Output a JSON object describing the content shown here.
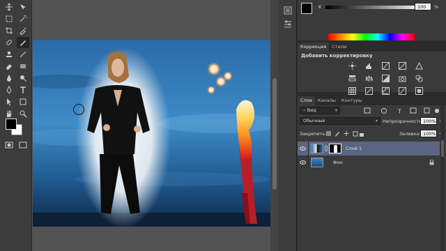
{
  "colors": {
    "sky_dark": "#1b3f63",
    "sky_light": "#3e86c2",
    "glow": "#e8eef4",
    "layer_selected": "#5a6582",
    "panel_bg": "#3a3a3a"
  },
  "toolbar": {
    "tools": [
      "move-tool-icon",
      "marquee-tool-icon",
      "lasso-tool-icon",
      "magic-wand-icon",
      "crop-tool-icon",
      "eyedropper-icon",
      "healing-brush-icon",
      "brush-tool-icon",
      "clone-stamp-icon",
      "history-brush-icon",
      "eraser-icon",
      "gradient-icon",
      "blur-icon",
      "dodge-icon",
      "pen-tool-icon",
      "type-tool-icon",
      "path-select-icon",
      "shape-tool-icon",
      "hand-tool-icon",
      "zoom-tool-icon"
    ]
  },
  "color_panel": {
    "channel_label": "K",
    "value": "100",
    "unit": "%"
  },
  "adjustments": {
    "tabs": [
      "Коррекция",
      "Стили"
    ],
    "title": "Добавить корректировку",
    "icons": [
      "brightness-icon",
      "levels-icon",
      "curves-icon",
      "exposure-icon",
      "vibrance-icon",
      "hue-saturation-icon",
      "color-balance-icon",
      "black-white-icon",
      "photo-filter-icon",
      "channel-mixer-icon",
      "color-lookup-icon",
      "invert-icon",
      "posterize-icon",
      "threshold-icon",
      "gradient-map-icon",
      "selective-color-icon"
    ]
  },
  "layers_panel": {
    "tabs": [
      "Слои",
      "Каналы",
      "Контуры"
    ],
    "filter": "Вид",
    "blend_mode": "Обычные",
    "opacity_label": "Непрозрачность:",
    "opacity_value": "100%",
    "lock_label": "Закрепить:",
    "fill_label": "Заливка:",
    "fill_value": "100%",
    "layers": [
      {
        "name": "Слой 1",
        "selected": true
      },
      {
        "name": "Фон",
        "selected": false,
        "locked": true
      }
    ]
  }
}
